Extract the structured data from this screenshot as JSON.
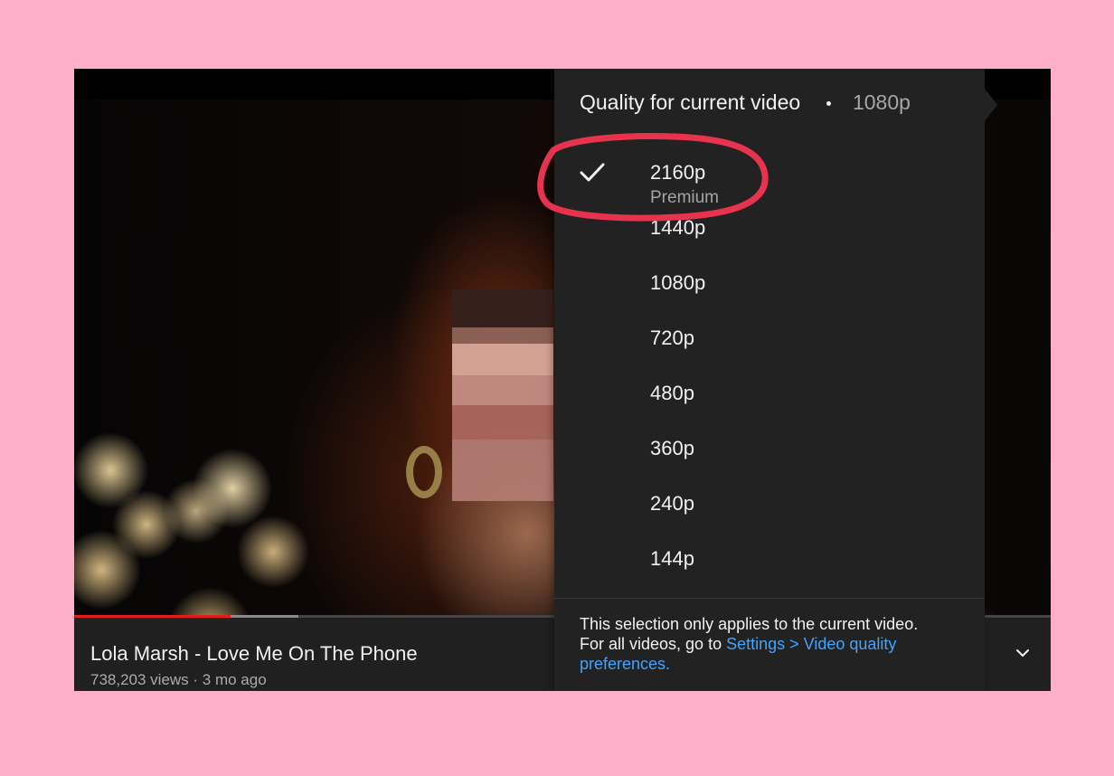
{
  "video": {
    "title": "Lola Marsh - Love Me On The Phone",
    "meta": "738,203 views · 3 mo ago",
    "progress_played_fraction": 0.16,
    "progress_buffered_fraction": 0.23
  },
  "quality_menu": {
    "header_label": "Quality for current video",
    "current_quality": "1080p",
    "options": [
      {
        "label": "2160p",
        "sublabel": "Premium",
        "selected": true
      },
      {
        "label": "1440p",
        "sublabel": "",
        "selected": false
      },
      {
        "label": "1080p",
        "sublabel": "",
        "selected": false
      },
      {
        "label": "720p",
        "sublabel": "",
        "selected": false
      },
      {
        "label": "480p",
        "sublabel": "",
        "selected": false
      },
      {
        "label": "360p",
        "sublabel": "",
        "selected": false
      },
      {
        "label": "240p",
        "sublabel": "",
        "selected": false
      },
      {
        "label": "144p",
        "sublabel": "",
        "selected": false
      }
    ],
    "footer_text_line1": "This selection only applies to the current video.",
    "footer_text_prefix": "For all videos, go to ",
    "footer_link_text": "Settings > Video quality preferences."
  },
  "icons": {
    "checkmark": "checkmark-icon",
    "expand": "chevron-down-icon"
  },
  "colors": {
    "background": "#ffafca",
    "menu_background": "#222222",
    "progress_played": "#e31e1e",
    "link": "#3ea6ff",
    "annotation_circle": "#e8334f"
  }
}
